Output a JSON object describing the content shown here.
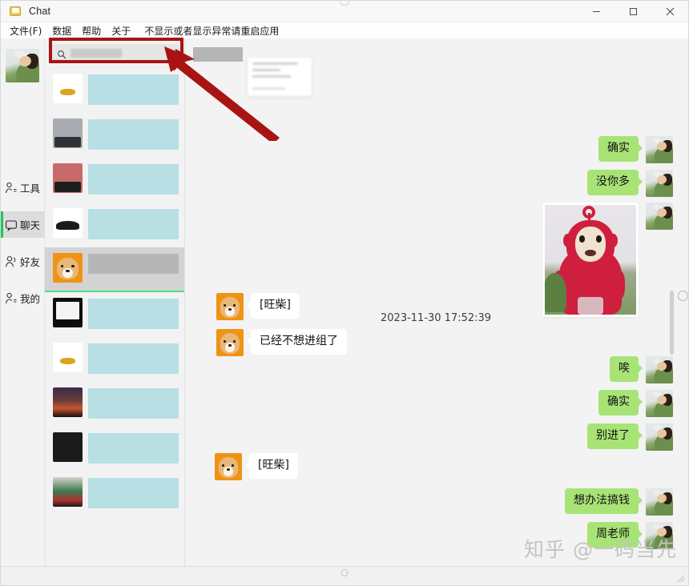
{
  "window": {
    "title": "Chat",
    "app_icon": "chat-app-icon",
    "controls": {
      "minimize": "—",
      "maximize": "□",
      "close": "✕"
    }
  },
  "menubar": {
    "items": [
      {
        "label": "文件(F)",
        "name": "menu-file"
      },
      {
        "label": "数据",
        "name": "menu-data"
      },
      {
        "label": "帮助",
        "name": "menu-help"
      },
      {
        "label": "关于",
        "name": "menu-about"
      }
    ],
    "notice": "不显示或者显示异常请重启应用"
  },
  "rail": {
    "avatar": "user-avatar",
    "items": [
      {
        "label": "工具",
        "icon": "tools-person-icon",
        "active": false
      },
      {
        "label": "聊天",
        "icon": "chat-bubble-icon",
        "active": true
      },
      {
        "label": "好友",
        "icon": "friends-icon",
        "active": false
      },
      {
        "label": "我的",
        "icon": "profile-person-icon",
        "active": false
      }
    ]
  },
  "search": {
    "icon": "search-icon",
    "placeholder": "",
    "value": "",
    "redacted": true
  },
  "chat_list": [
    {
      "avatar": "av-white",
      "selected": false,
      "redaction": "wide"
    },
    {
      "avatar": "av-gray",
      "selected": false,
      "redaction": "wide"
    },
    {
      "avatar": "av-redpc",
      "selected": false,
      "redaction": "wide"
    },
    {
      "avatar": "av-cap",
      "selected": false,
      "redaction": "wide"
    },
    {
      "avatar": "av-doge",
      "selected": true,
      "redaction": "gray"
    },
    {
      "avatar": "av-blackpc",
      "selected": false,
      "redaction": "wide"
    },
    {
      "avatar": "av-white",
      "selected": false,
      "redaction": "wide"
    },
    {
      "avatar": "av-night",
      "selected": false,
      "redaction": "wide"
    },
    {
      "avatar": "av-dark",
      "selected": false,
      "redaction": "wide"
    },
    {
      "avatar": "av-collage",
      "selected": false,
      "redaction": "wide"
    }
  ],
  "conversation": {
    "title_redacted": true,
    "timestamp": "2023-11-30 17:52:39",
    "messages": [
      {
        "side": "right",
        "type": "text",
        "text": "确实",
        "avatar": "grass"
      },
      {
        "side": "right",
        "type": "text",
        "text": "没你多",
        "avatar": "grass"
      },
      {
        "side": "right",
        "type": "image",
        "text": "",
        "avatar": "grass",
        "image": "teletubby-po-photo"
      },
      {
        "side": "left",
        "type": "text",
        "text": "[旺柴]",
        "avatar": "doge"
      },
      {
        "side": "left",
        "type": "text",
        "text": "已经不想进组了",
        "avatar": "doge"
      },
      {
        "side": "right",
        "type": "text",
        "text": "唉",
        "avatar": "grass"
      },
      {
        "side": "right",
        "type": "text",
        "text": "确实",
        "avatar": "grass"
      },
      {
        "side": "right",
        "type": "text",
        "text": "别进了",
        "avatar": "grass"
      },
      {
        "side": "left",
        "type": "text",
        "text": "[旺柴]",
        "avatar": "doge"
      },
      {
        "side": "right",
        "type": "text",
        "text": "想办法搞钱",
        "avatar": "grass"
      },
      {
        "side": "right",
        "type": "text",
        "text": "周老师",
        "avatar": "grass"
      }
    ]
  },
  "annotation": {
    "box_color": "#a81414",
    "arrow_color": "#a81414",
    "target": "search-input"
  },
  "watermark": "知乎 @一码当先",
  "colors": {
    "accent_green": "#22c45d",
    "bubble_out": "#a8e376",
    "bubble_in": "#ffffff",
    "redaction_blue": "#b8dfe4",
    "redaction_gray": "#b5b5b5",
    "annotation_red": "#a81414"
  }
}
